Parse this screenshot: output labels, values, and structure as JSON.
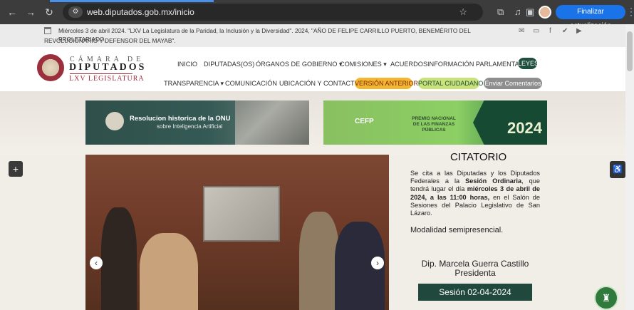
{
  "browser": {
    "url": "web.diputados.gob.mx/inicio",
    "update_button": "Finalizar actualización",
    "icons": [
      "back-icon",
      "forward-icon",
      "reload-icon",
      "site-info-icon",
      "star-icon",
      "extensions-icon",
      "media-icon",
      "side-panel-icon",
      "profile-avatar",
      "kebab-menu-icon"
    ]
  },
  "info_bar": {
    "line1": "Miércoles 3 de abril 2024.  \"LXV La Legislatura de la Paridad, la Inclusión y la Diversidad\". 2024, \"AÑO DE FELIPE CARRILLO PUERTO, BENEMÉRITO DEL PROLETARIADO,",
    "line2": "REVOLUCIONARIO Y DEFENSOR DEL MAYAB\"."
  },
  "logo": {
    "top": "CÁMARA DE",
    "main": "DIPUTADOS",
    "sub": "LXV LEGISLATURA"
  },
  "nav": {
    "row1": [
      "INICIO",
      "DIPUTADAS(OS)",
      "ÓRGANOS DE GOBIERNO ▾",
      "COMISIONES ▾",
      "ACUERDOS",
      "INFORMACIÓN PARLAMENTARIA"
    ],
    "leyes": "LEYES",
    "row2": [
      "TRANSPARENCIA ▾",
      "COMUNICACIÓN",
      "UBICACIÓN Y CONTACTO"
    ],
    "version_anterior": "VERSIÓN ANTERIOR",
    "portal_ciudadano": "PORTAL CIUDADANO",
    "enviar": "Enviar Comentarios"
  },
  "banners": {
    "left_title": "Resolucion historica de la ONU",
    "left_sub": "sobre Inteligencia Artificial",
    "right_logo": "CEFP",
    "right_premio": "PREMIO NACIONAL DE LAS FINANZAS PÚBLICAS",
    "right_year": "2024"
  },
  "citatorio": {
    "title": "CITATORIO",
    "text_a": "Se cita a las Diputadas y los Diputados Federales a la ",
    "text_b": "Sesión Ordinaria",
    "text_c": ", que tendrá lugar el día ",
    "text_d": "miércoles 3 de abril de 2024, a las 11:00 horas,",
    "text_e": " en el Salón de Sesiones del Palacio Legislativo de San Lázaro.",
    "modalidad": "Modalidad semipresencial.",
    "dip_name": "Dip. Marcela Guerra Castillo",
    "dip_role": "Presidenta",
    "sesion_button": "Sesión 02-04-2024"
  },
  "colors": {
    "chrome_bg": "#3c3c3c",
    "update_button": "#1a73e8",
    "brand_wine": "#9c2f3c",
    "leyes_pill": "#1f4f3e",
    "version_pill": "#f2b632",
    "portal_pill": "#c9e27a",
    "enviar_pill": "#8e8e8e",
    "sesion_button": "#20483d"
  }
}
